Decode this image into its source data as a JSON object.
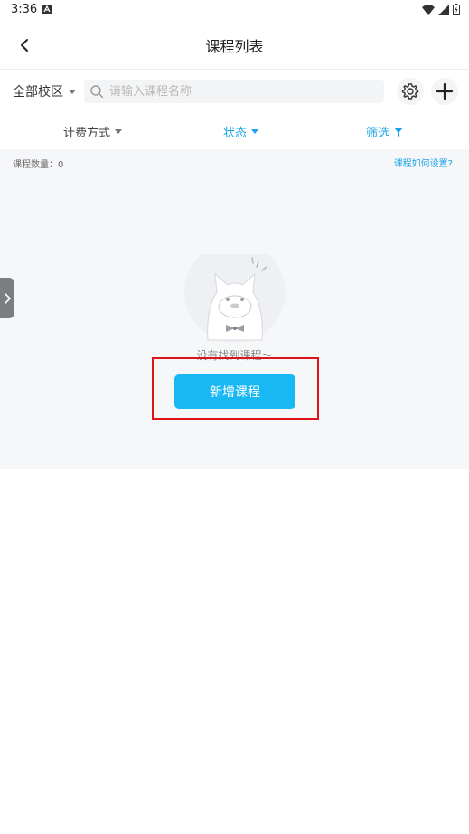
{
  "status_bar": {
    "time": "3:36",
    "notification_icon": "a-letter-icon",
    "icons": [
      "wifi-icon",
      "cellular-signal-icon",
      "battery-icon"
    ]
  },
  "header": {
    "title": "课程列表",
    "back_icon": "chevron-left-icon"
  },
  "filters": {
    "campus_label": "全部校区",
    "search_placeholder": "请输入课程名称",
    "search_value": "",
    "settings_icon": "gear-icon",
    "add_icon": "plus-icon"
  },
  "tabs": {
    "billing_label": "计费方式",
    "status_label": "状态",
    "filter_label": "筛选"
  },
  "content": {
    "course_count_label": "课程数量：0",
    "help_link": "课程如何设置?",
    "empty_text": "没有找到课程～",
    "add_button_label": "新增课程"
  },
  "colors": {
    "accent": "#1aa3e8",
    "button": "#18b8f5",
    "highlight": "#e0121b",
    "content_bg": "#f6f7f9"
  }
}
